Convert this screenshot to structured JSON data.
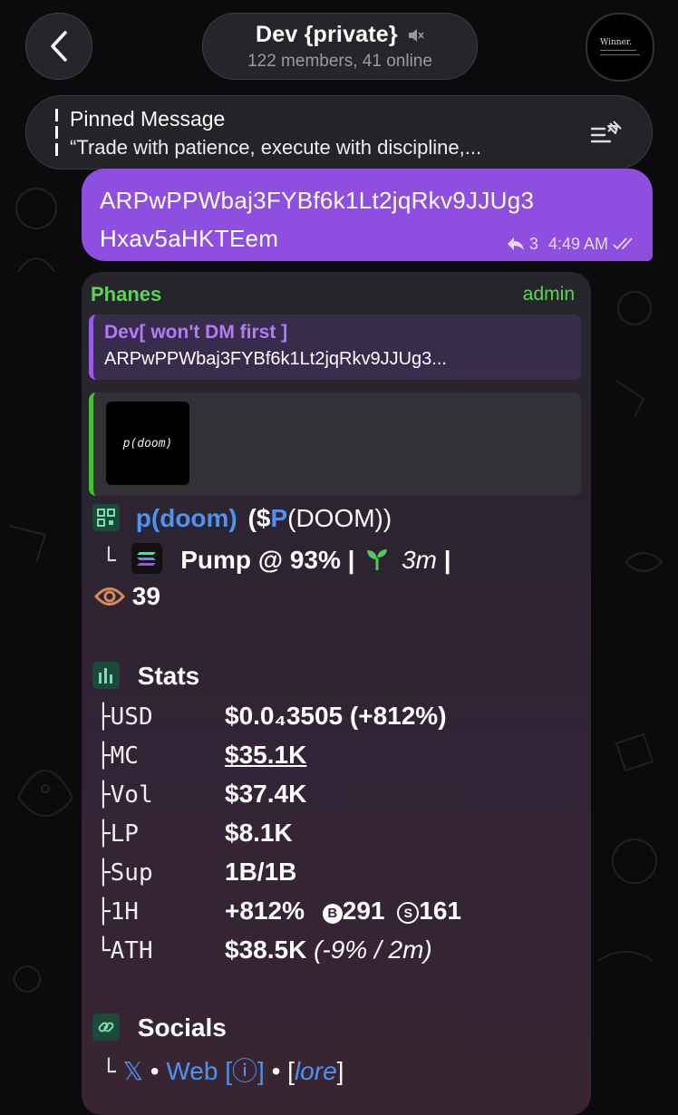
{
  "header": {
    "back_glyph": "‹",
    "title": "Dev {private}",
    "subtitle": "122 members, 41 online",
    "avatar_text": "Winner."
  },
  "pinned": {
    "label": "Pinned Message",
    "text": "“Trade with patience, execute with discipline,..."
  },
  "outgoing": {
    "address_line1": "ARPwPPWbaj3FYBf6k1Lt2jqRkv9JJUg3",
    "address_line2": "Hxav5aHKTEem",
    "reply_count": "3",
    "time": "4:49 AM"
  },
  "incoming": {
    "sender": "Phanes",
    "role": "admin",
    "reply_to_name": "Dev[ won't DM first ]",
    "reply_to_text": "ARPwPPWbaj3FYBf6k1Lt2jqRkv9JJUg3...",
    "preview_thumb_text": "p(doom)",
    "token_name": "p(doom)",
    "ticker_open": "($",
    "ticker": "P",
    "ticker_rest": "(DOOM))",
    "tree_branch": "└",
    "pump_text": "Pump @ 93% |",
    "age_text": "3m",
    "age_sep": "|",
    "views": "39",
    "stats_title": "Stats",
    "stats": [
      {
        "key": "├USD",
        "value": "$0.0₄3505 (+812%)"
      },
      {
        "key": "├MC",
        "value": "$35.1K"
      },
      {
        "key": "├Vol",
        "value": "$37.4K"
      },
      {
        "key": "├LP",
        "value": "$8.1K"
      },
      {
        "key": "├Sup",
        "value": "1B/1B"
      },
      {
        "key": "├1H",
        "value": "+812%"
      },
      {
        "key": "└ATH",
        "value": "$38.5K"
      }
    ],
    "buys": "291",
    "sells": "161",
    "ath_extra": "(-9% / 2m)",
    "socials_title": "Socials",
    "socials_branch": "└",
    "x_label": "𝕏",
    "dot": "•",
    "web_label": "Web",
    "info_label": "[ⓘ]",
    "lore_open": "[",
    "lore_label": "lore",
    "lore_close": "]"
  },
  "colors": {
    "outgoing_bubble": "#8e4fe0",
    "admin_green": "#5ed35b",
    "link_blue": "#4f92f2",
    "reply_purple": "#b47cf2"
  }
}
